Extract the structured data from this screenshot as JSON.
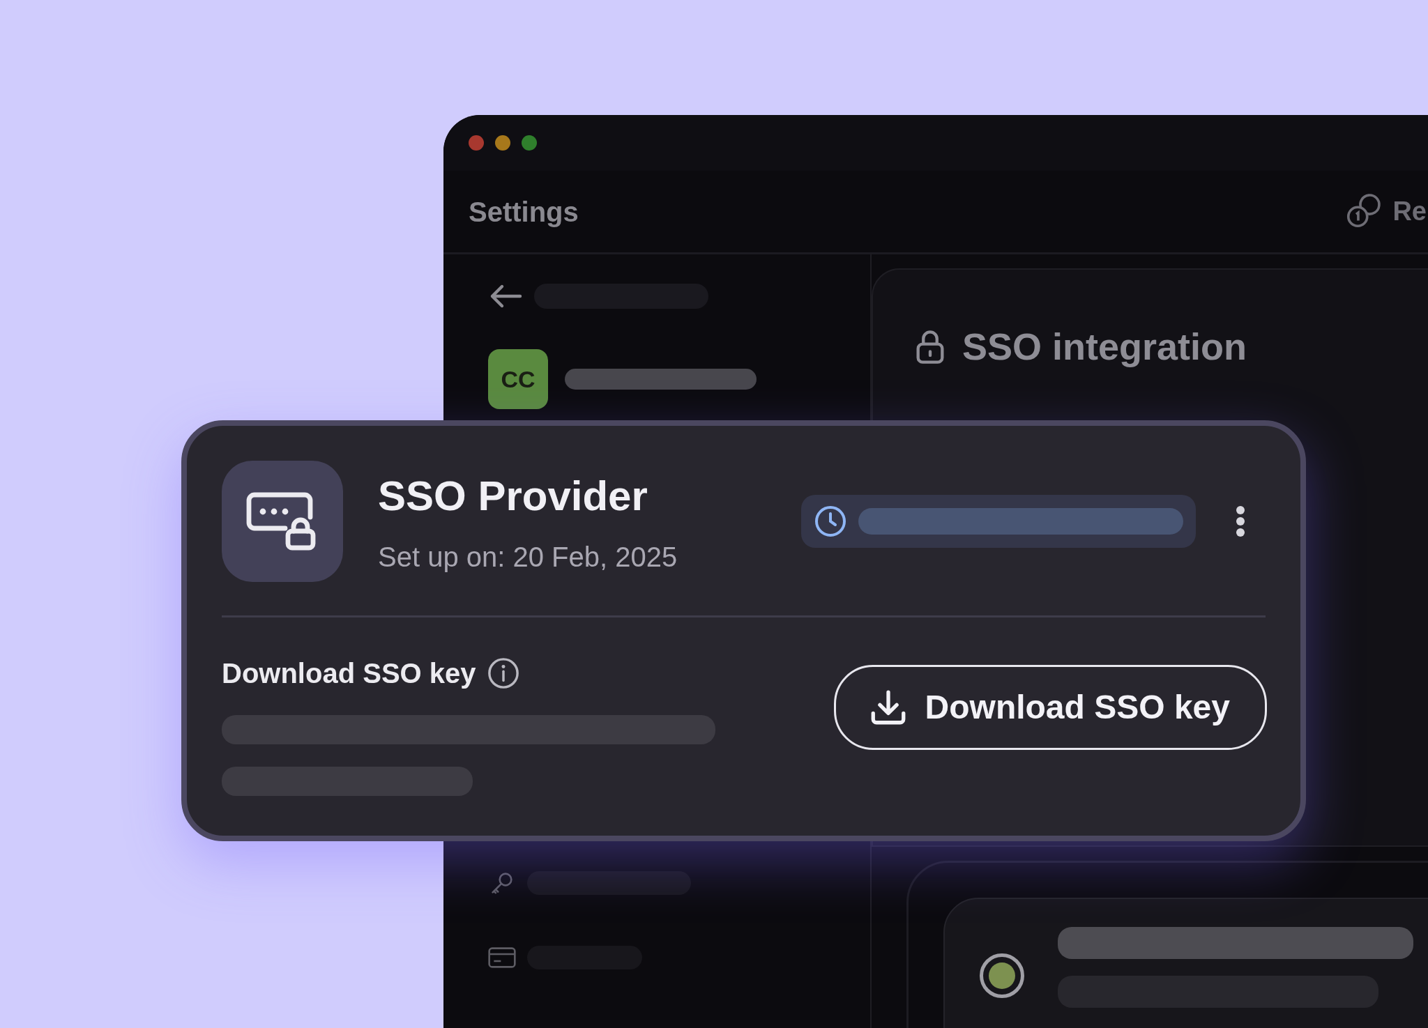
{
  "window": {
    "header": {
      "title": "Settings",
      "right_label": "Re"
    },
    "sidebar": {
      "avatar": "CC"
    },
    "panel": {
      "title": "SSO integration",
      "option": {
        "selected": true
      }
    }
  },
  "card": {
    "title": "SSO Provider",
    "subtitle": "Set up on: 20 Feb, 2025",
    "section_label": "Download SSO key",
    "button": "Download SSO key"
  }
}
